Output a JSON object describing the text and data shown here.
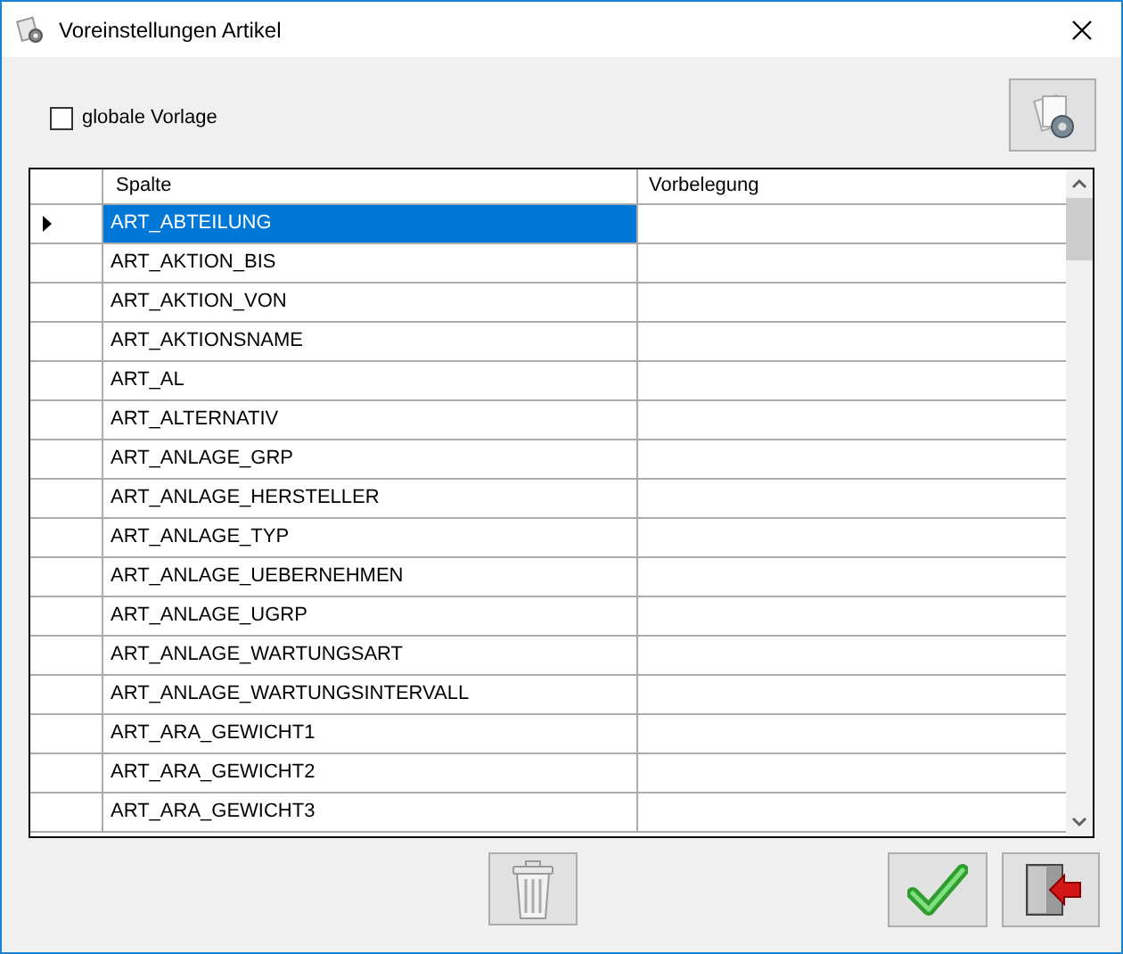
{
  "window": {
    "title": "Voreinstellungen Artikel"
  },
  "global_template": {
    "label": "globale Vorlage",
    "checked": false
  },
  "table": {
    "columns": [
      "Spalte",
      "Vorbelegung"
    ],
    "rows": [
      {
        "spalte": "ART_ABTEILUNG",
        "selected": true
      },
      {
        "spalte": "ART_AKTION_BIS",
        "selected": false
      },
      {
        "spalte": "ART_AKTION_VON",
        "selected": false
      },
      {
        "spalte": "ART_AKTIONSNAME",
        "selected": false
      },
      {
        "spalte": "ART_AL",
        "selected": false
      },
      {
        "spalte": "ART_ALTERNATIV",
        "selected": false
      },
      {
        "spalte": "ART_ANLAGE_GRP",
        "selected": false
      },
      {
        "spalte": "ART_ANLAGE_HERSTELLER",
        "selected": false
      },
      {
        "spalte": "ART_ANLAGE_TYP",
        "selected": false
      },
      {
        "spalte": "ART_ANLAGE_UEBERNEHMEN",
        "selected": false
      },
      {
        "spalte": "ART_ANLAGE_UGRP",
        "selected": false
      },
      {
        "spalte": "ART_ANLAGE_WARTUNGSART",
        "selected": false
      },
      {
        "spalte": "ART_ANLAGE_WARTUNGSINTERVALL",
        "selected": false
      },
      {
        "spalte": "ART_ARA_GEWICHT1",
        "selected": false
      },
      {
        "spalte": "ART_ARA_GEWICHT2",
        "selected": false
      },
      {
        "spalte": "ART_ARA_GEWICHT3",
        "selected": false
      }
    ]
  }
}
